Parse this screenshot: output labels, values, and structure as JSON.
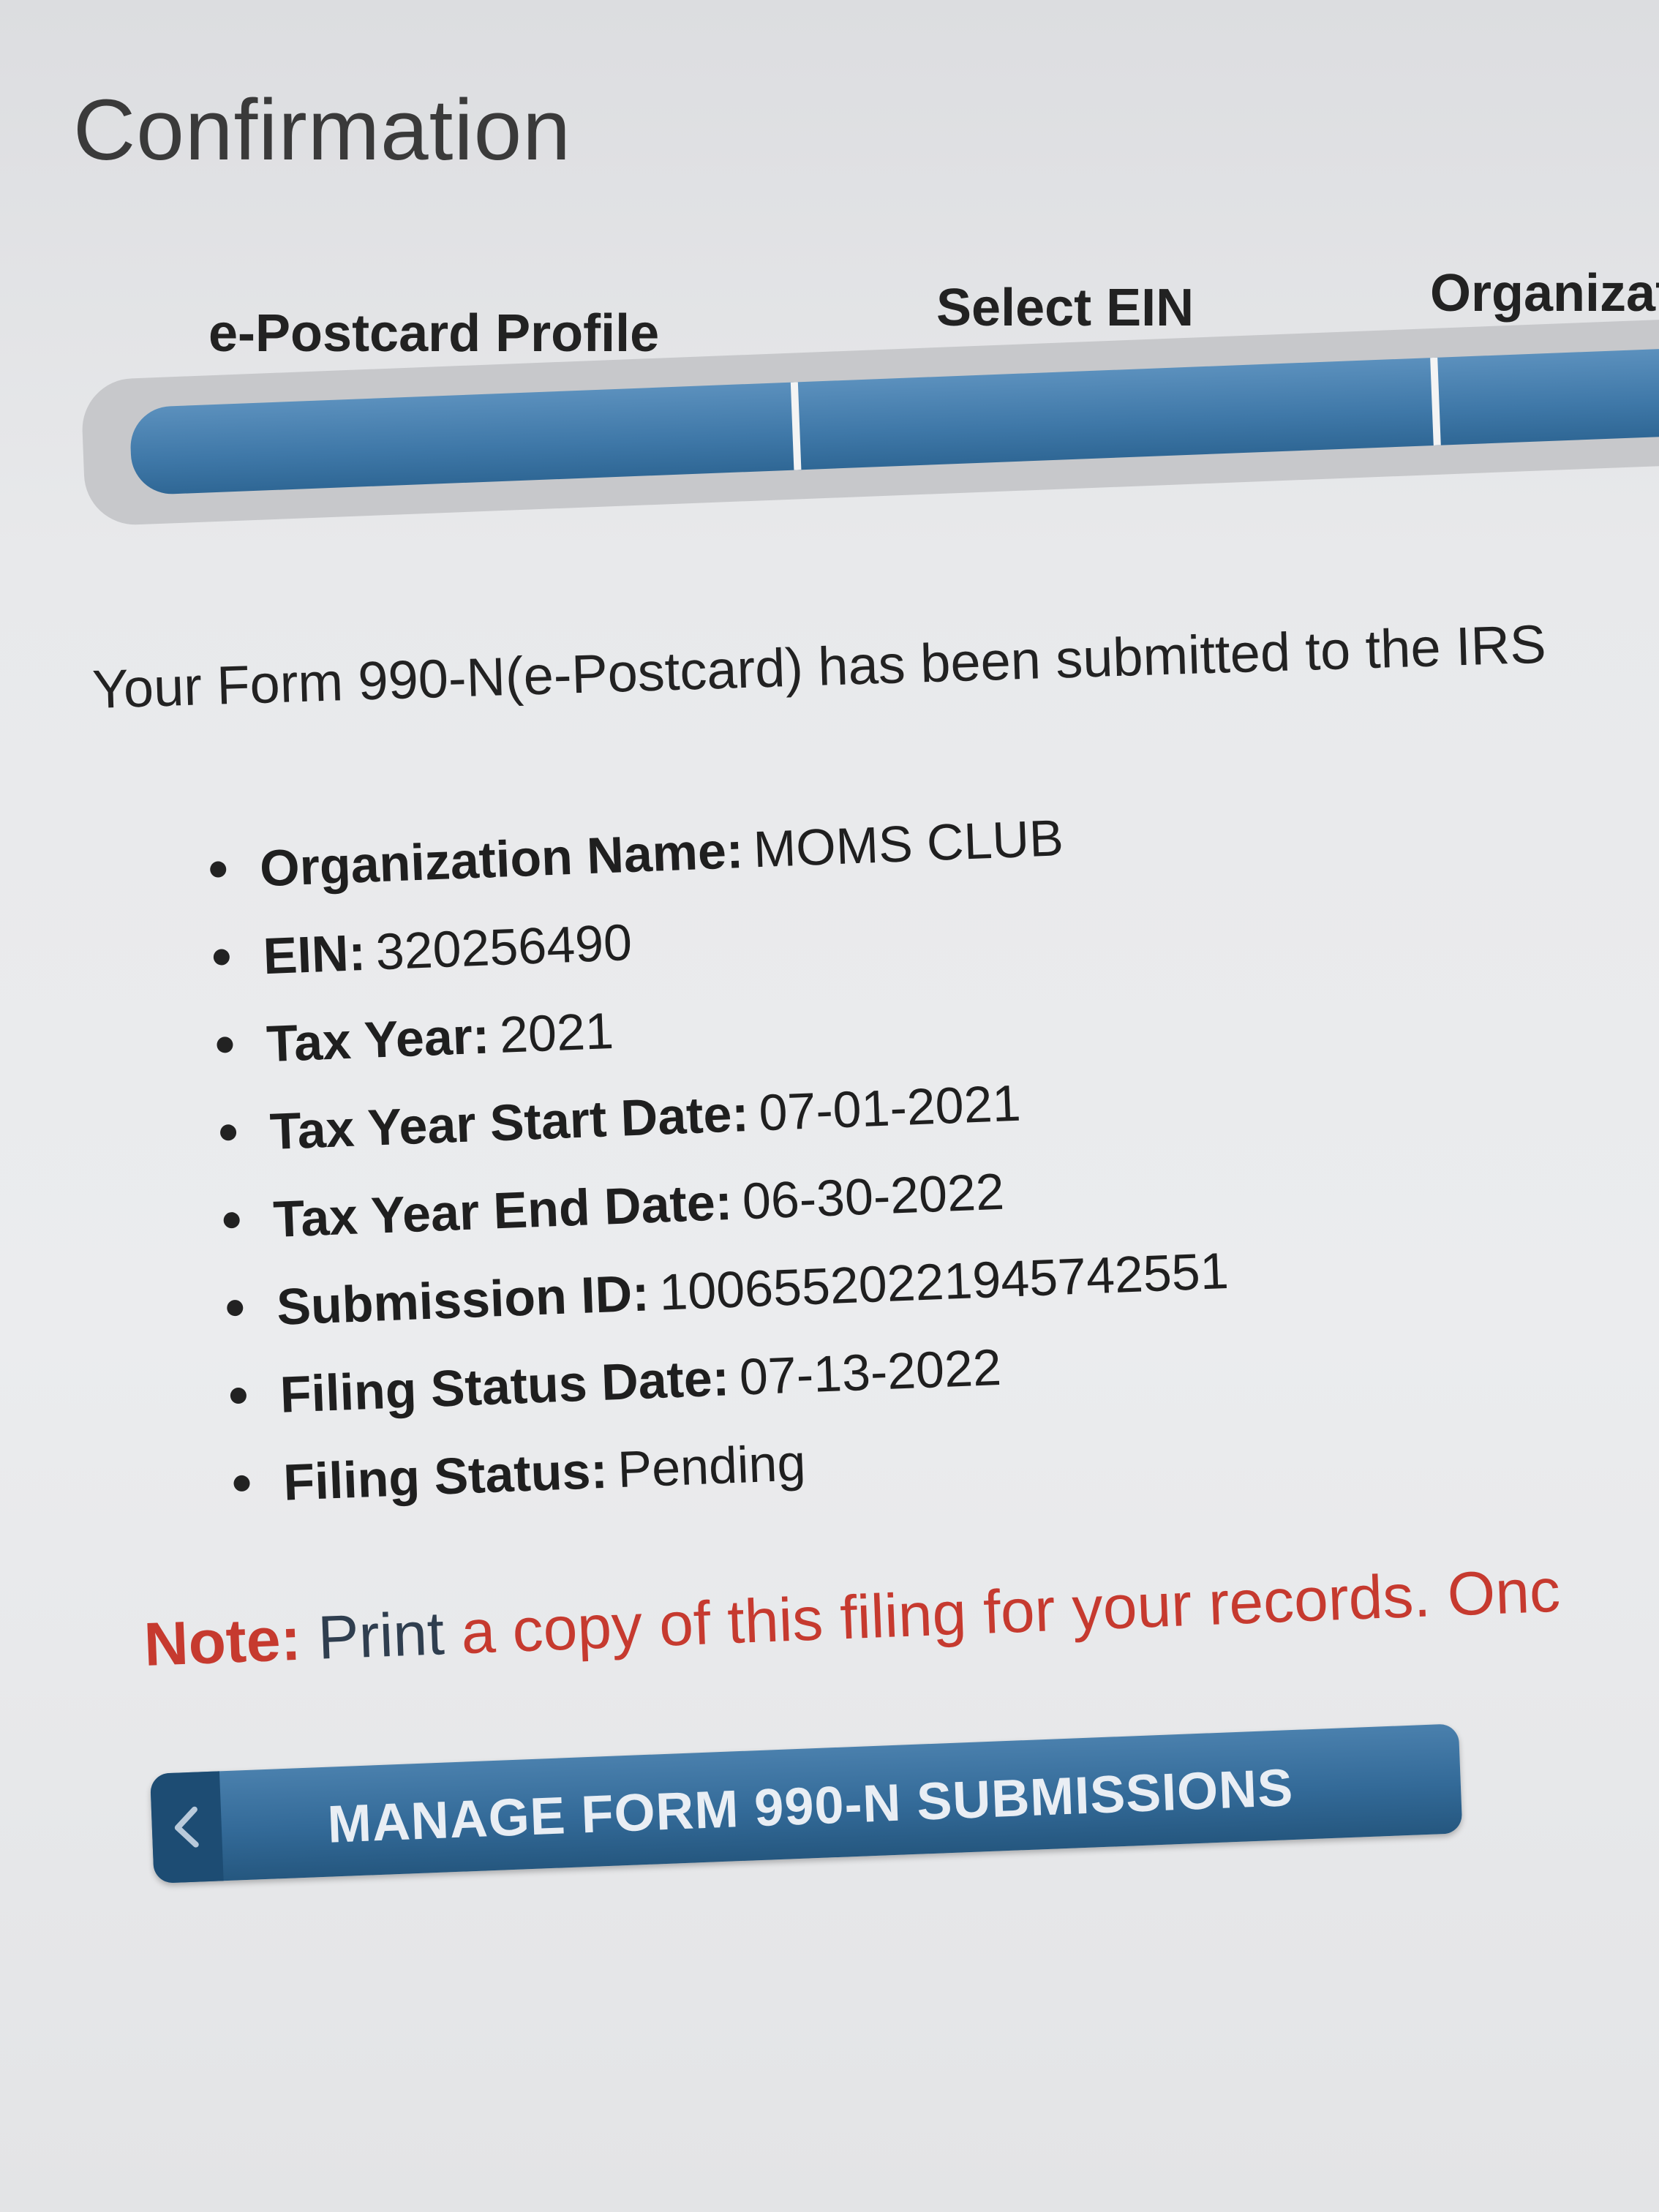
{
  "page": {
    "title": "Confirmation"
  },
  "wizard": {
    "steps": [
      {
        "label": "e-Postcard Profile"
      },
      {
        "label": "Select EIN"
      },
      {
        "label": "Organizat"
      }
    ],
    "progress_fraction": 1.0,
    "accent_color": "#3f78a8"
  },
  "confirmation": {
    "message": "Your Form 990-N(e-Postcard) has been submitted to the IRS"
  },
  "details": [
    {
      "label": "Organization Name:",
      "value": "MOMS CLUB"
    },
    {
      "label": "EIN:",
      "value": "320256490"
    },
    {
      "label": "Tax Year:",
      "value": "2021"
    },
    {
      "label": "Tax Year Start Date:",
      "value": "07-01-2021"
    },
    {
      "label": "Tax Year End Date:",
      "value": "06-30-2022"
    },
    {
      "label": "Submission ID:",
      "value": "10065520221945742551"
    },
    {
      "label": "Filing Status Date:",
      "value": "07-13-2022"
    },
    {
      "label": "Filing Status:",
      "value": "Pending"
    }
  ],
  "note": {
    "label": "Note:",
    "print_word": "Print",
    "text": " a copy of this filing for your records. Onc",
    "color": "#c63a2f"
  },
  "actions": {
    "manage_button_label": "MANAGE FORM 990-N SUBMISSIONS",
    "manage_button_icon": "chevron-left-icon"
  }
}
